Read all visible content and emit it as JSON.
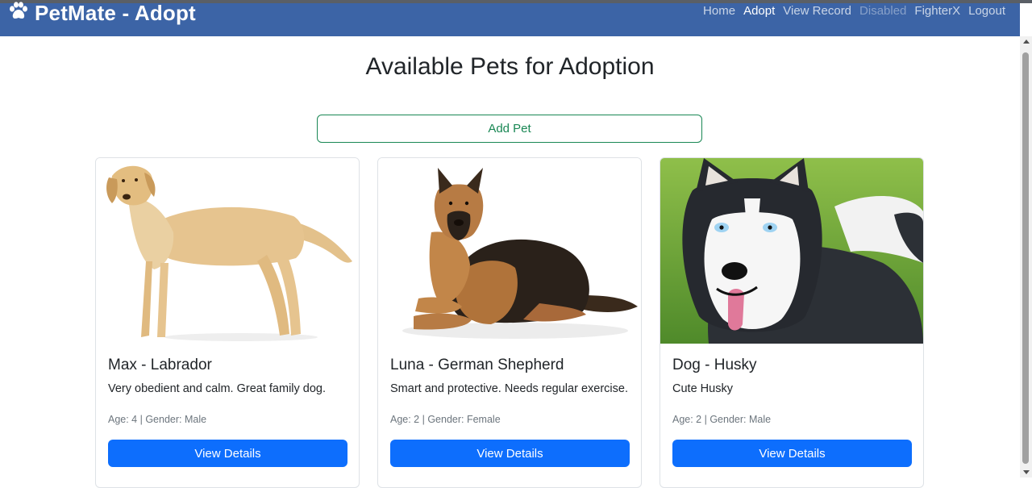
{
  "navbar": {
    "brand": "PetMate - Adopt",
    "brand_icon": "paw-icon",
    "links": [
      {
        "label": "Home",
        "state": "normal"
      },
      {
        "label": "Adopt",
        "state": "active"
      },
      {
        "label": "View Record",
        "state": "normal"
      },
      {
        "label": "Disabled",
        "state": "disabled"
      },
      {
        "label": "FighterX",
        "state": "normal"
      },
      {
        "label": "Logout",
        "state": "normal"
      }
    ]
  },
  "page": {
    "title": "Available Pets for Adoption",
    "add_button": "Add Pet"
  },
  "pets": [
    {
      "title": "Max - Labrador",
      "description": "Very obedient and calm. Great family dog.",
      "meta": "Age: 4 | Gender: Male",
      "button": "View Details",
      "photo": "labrador-photo"
    },
    {
      "title": "Luna - German Shepherd",
      "description": "Smart and protective. Needs regular exercise.",
      "meta": "Age: 2 | Gender: Female",
      "button": "View Details",
      "photo": "german-shepherd-photo"
    },
    {
      "title": "Dog - Husky",
      "description": "Cute Husky",
      "meta": "Age: 2 | Gender: Male",
      "button": "View Details",
      "photo": "husky-photo"
    }
  ],
  "colors": {
    "navbar": "#3c64a6",
    "primary": "#0d6efd",
    "success": "#198754"
  }
}
